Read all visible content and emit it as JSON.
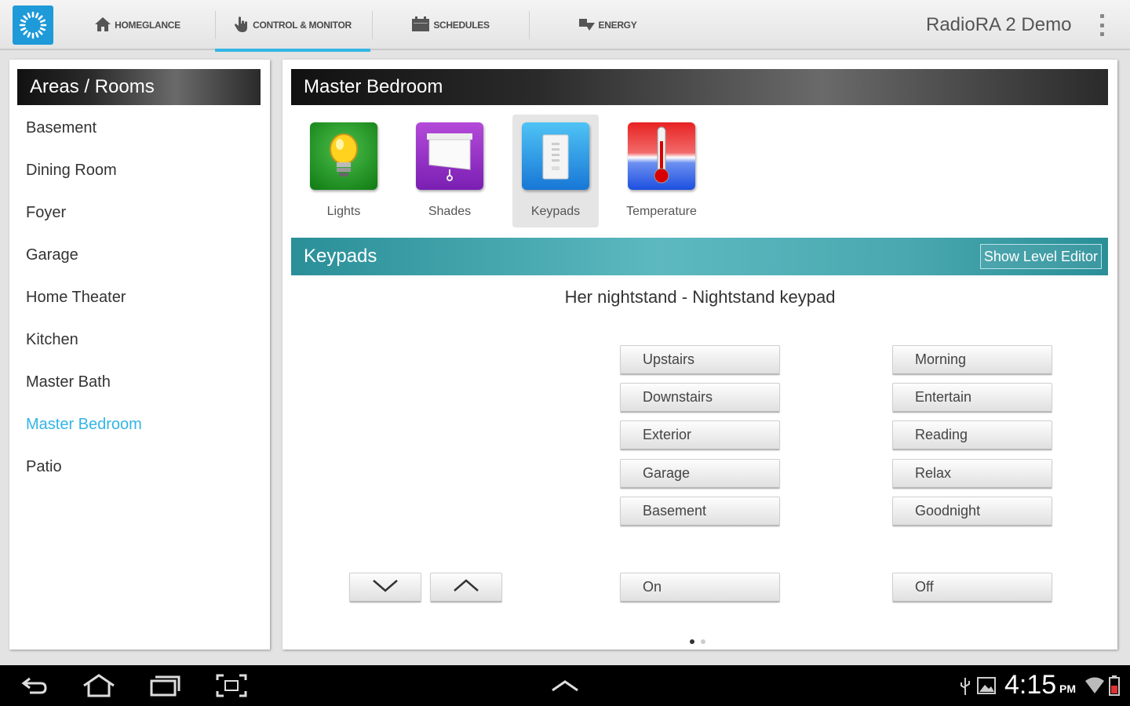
{
  "app": {
    "title": "RadioRA 2 Demo",
    "logo_icon": "sunburst-logo-icon",
    "accent_color": "#33b5e5"
  },
  "tabs": [
    {
      "label": "HOMEGLANCE",
      "icon": "home-icon",
      "active": false
    },
    {
      "label": "CONTROL & MONITOR",
      "icon": "hand-pointer-icon",
      "active": true
    },
    {
      "label": "SCHEDULES",
      "icon": "calendar-icon",
      "active": false
    },
    {
      "label": "ENERGY",
      "icon": "energy-icon",
      "active": false
    }
  ],
  "sidebar": {
    "header": "Areas / Rooms",
    "rooms": [
      {
        "label": "Basement",
        "selected": false
      },
      {
        "label": "Dining Room",
        "selected": false
      },
      {
        "label": "Foyer",
        "selected": false
      },
      {
        "label": "Garage",
        "selected": false
      },
      {
        "label": "Home Theater",
        "selected": false
      },
      {
        "label": "Kitchen",
        "selected": false
      },
      {
        "label": "Master Bath",
        "selected": false
      },
      {
        "label": "Master Bedroom",
        "selected": true
      },
      {
        "label": "Patio",
        "selected": false
      }
    ]
  },
  "main": {
    "room_title": "Master Bedroom",
    "categories": [
      {
        "label": "Lights",
        "icon": "lightbulb-icon",
        "active": false
      },
      {
        "label": "Shades",
        "icon": "shade-icon",
        "active": false
      },
      {
        "label": "Keypads",
        "icon": "keypad-icon",
        "active": true
      },
      {
        "label": "Temperature",
        "icon": "thermometer-icon",
        "active": false
      }
    ],
    "section_title": "Keypads",
    "level_editor_label": "Show Level Editor",
    "keypad_name": "Her nightstand - Nightstand keypad",
    "left_buttons": [
      "Upstairs",
      "Downstairs",
      "Exterior",
      "Garage",
      "Basement"
    ],
    "right_buttons": [
      "Morning",
      "Entertain",
      "Reading",
      "Relax",
      "Goodnight"
    ],
    "lower_icon": "chevron-down-icon",
    "raise_icon": "chevron-up-icon",
    "on_label": "On",
    "off_label": "Off",
    "pager": {
      "pages": 2,
      "current": 1
    }
  },
  "system_bar": {
    "time": "4:15",
    "ampm": "PM",
    "nav_icons": [
      "back-icon",
      "home-icon",
      "recent-apps-icon",
      "screenshot-icon"
    ],
    "status_icons": [
      "usb-icon",
      "gallery-icon",
      "wifi-icon",
      "battery-icon"
    ]
  }
}
